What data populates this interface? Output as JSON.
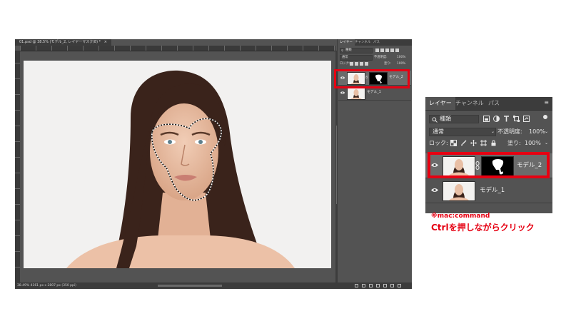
{
  "document": {
    "tab_title": "01.psd @ 38.5% (モデル_2, レイヤーマスク/8) *",
    "tab_close": "×",
    "status": "38.49%   4161 px x 2807 px (350 ppi)"
  },
  "panel_small": {
    "tabs": [
      "レイヤー",
      "チャンネル",
      "パス"
    ],
    "kind_label": "種類",
    "blend_mode": "通常",
    "opacity_label": "不透明度:",
    "opacity_value": "100%",
    "lock_label": "ロック:",
    "fill_label": "塗り:",
    "fill_value": "100%",
    "layers": [
      {
        "name": "モデル_2",
        "selected": true
      },
      {
        "name": "モデル_1",
        "selected": false
      }
    ]
  },
  "panel_large": {
    "tabs": [
      "レイヤー",
      "チャンネル",
      "パス"
    ],
    "kind_label": "種類",
    "blend_mode": "通常",
    "opacity_label": "不透明度:",
    "opacity_value": "100%",
    "lock_label": "ロック:",
    "fill_label": "塗り:",
    "fill_value": "100%",
    "layers": [
      {
        "name": "モデル_2",
        "selected": true
      },
      {
        "name": "モデル_1",
        "selected": false
      }
    ]
  },
  "annotation": {
    "note_mac": "※mac:command",
    "instruction": "Ctrlを押しながらクリック"
  },
  "colors": {
    "highlight": "#e60012",
    "ui_bg": "#535353",
    "ui_dark": "#3c3c3c"
  },
  "icons": [
    "eye-icon",
    "search-icon",
    "chain-link-icon",
    "brush-icon",
    "move-icon",
    "lock-icon",
    "fx-icon",
    "mask-icon",
    "adjustment-icon",
    "folder-icon",
    "new-layer-icon",
    "trash-icon"
  ]
}
